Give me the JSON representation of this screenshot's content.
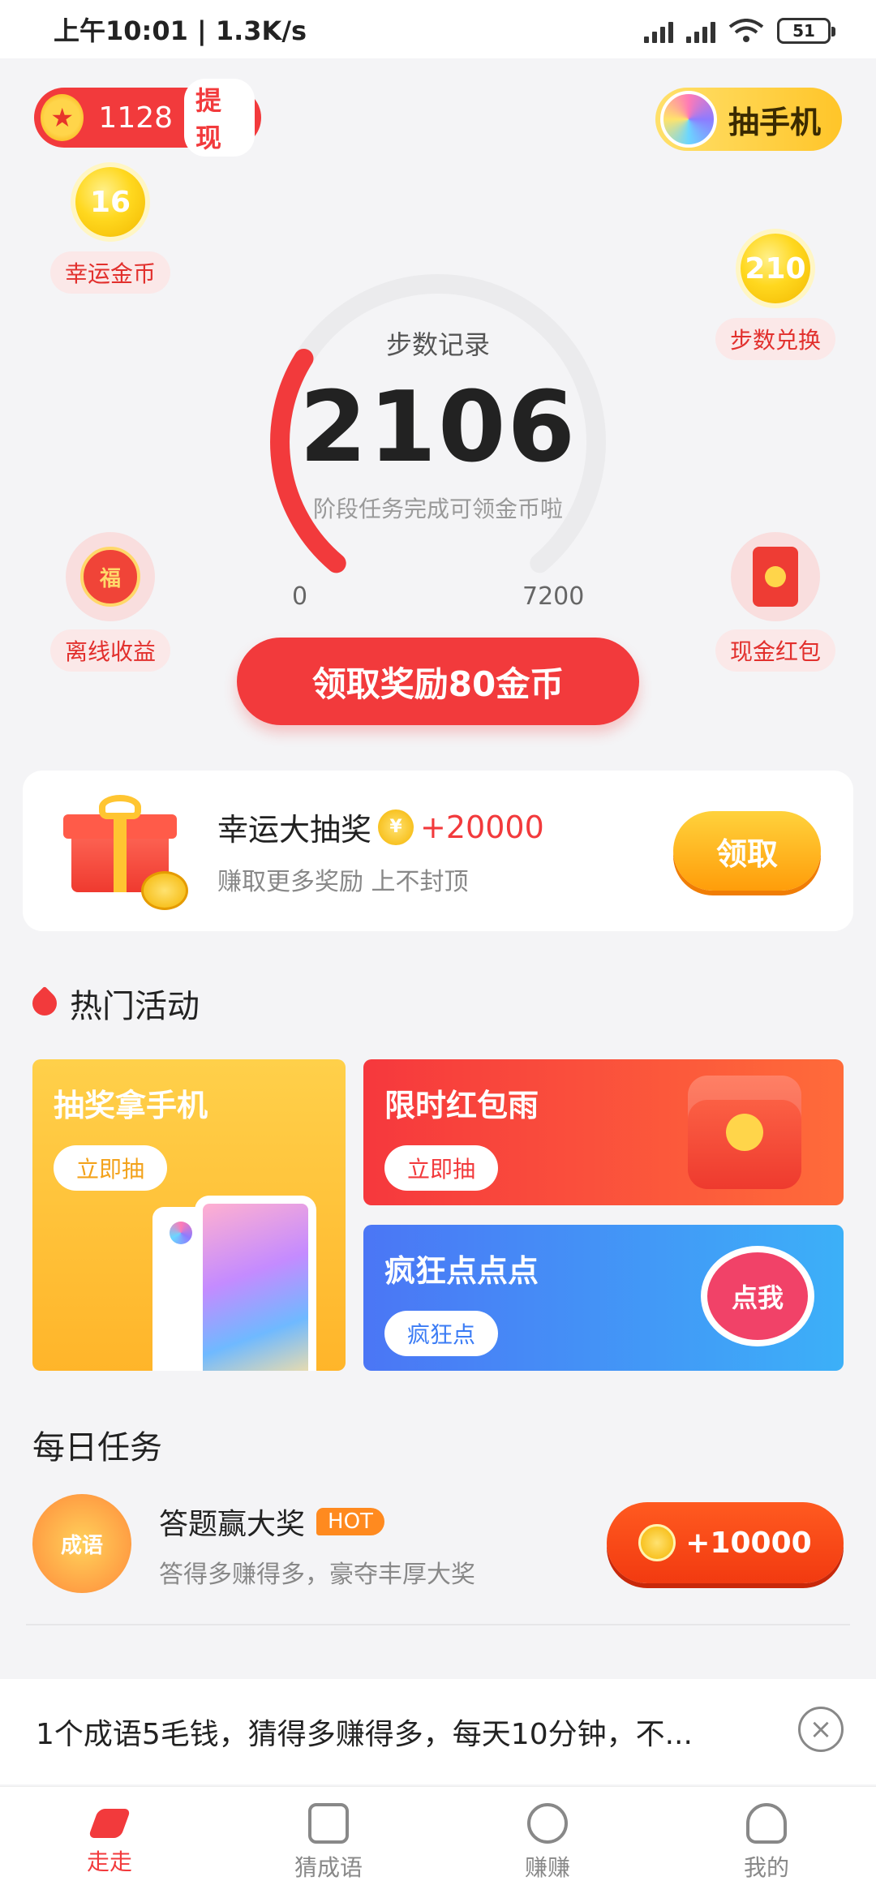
{
  "status": {
    "time": "上午10:01 | 1.3K/s",
    "battery": "51",
    "network": "HD"
  },
  "header": {
    "coins": "1128",
    "withdraw": "提现",
    "phone_draw": "抽手机"
  },
  "side": {
    "lucky_coin_value": "16",
    "lucky_coin_label": "幸运金币",
    "step_exchange_value": "210",
    "step_exchange_label": "步数兑换",
    "offline_icon": "福",
    "offline_label": "离线收益",
    "cash_label": "现金红包"
  },
  "gauge": {
    "title": "步数记录",
    "steps": "2106",
    "sub": "阶段任务完成可领金币啦",
    "min": "0",
    "max": "7200",
    "progress_fraction": 0.2925
  },
  "claim_button": "领取奖励80金币",
  "lottery": {
    "title": "幸运大抽奖",
    "coin_symbol": "¥",
    "amount": "+20000",
    "sub": "赚取更多奖励 上不封顶",
    "button": "领取"
  },
  "hot": {
    "title": "热门活动",
    "items": [
      {
        "title": "抽奖拿手机",
        "action": "立即抽"
      },
      {
        "title": "限时红包雨",
        "action": "立即抽"
      },
      {
        "title": "疯狂点点点",
        "action": "疯狂点",
        "tap": "点我"
      }
    ]
  },
  "daily": {
    "title": "每日任务",
    "task": {
      "icon_text": "成语",
      "title": "答题赢大奖",
      "badge": "HOT",
      "sub": "答得多赚得多，豪夺丰厚大奖",
      "reward": "+10000"
    }
  },
  "banner": {
    "text": "1个成语5毛钱，猜得多赚得多，每天10分钟，不...",
    "close": "×"
  },
  "tabs": [
    "走走",
    "猜成语",
    "赚赚",
    "我的"
  ],
  "colors": {
    "accent": "#f23a3c",
    "gold": "#ffc529",
    "blue": "#3b7cf5"
  }
}
